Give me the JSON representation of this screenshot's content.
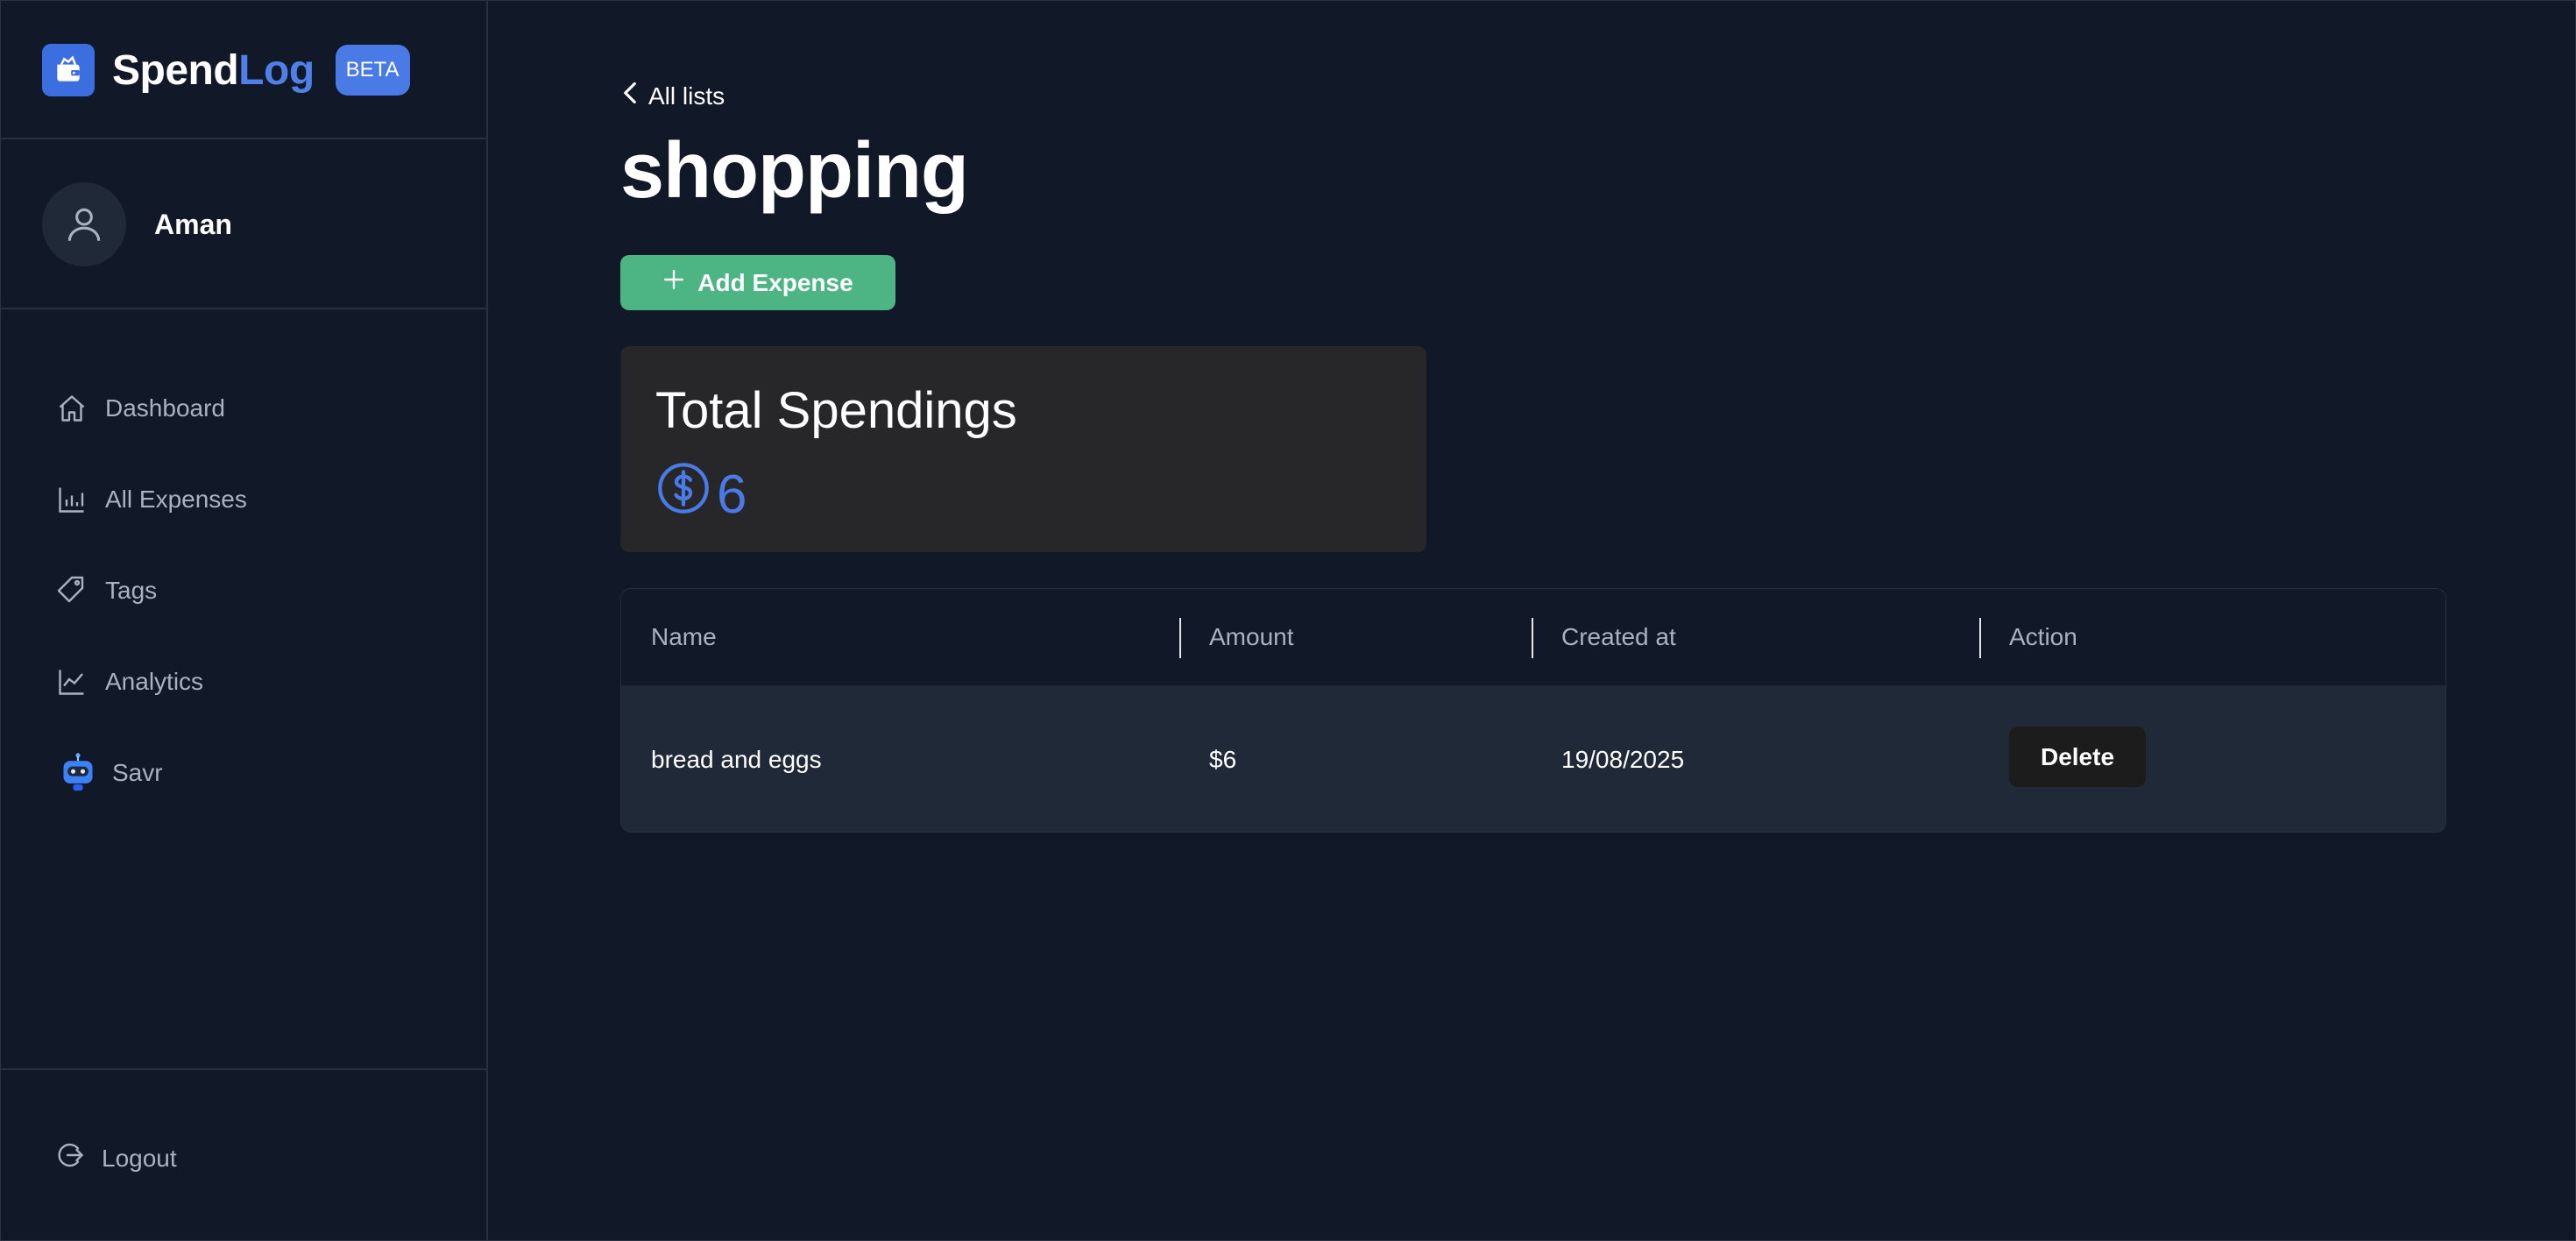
{
  "brand": {
    "name_part1": "Spend",
    "name_part2": "Log",
    "badge": "BETA"
  },
  "user": {
    "name": "Aman"
  },
  "sidebar": {
    "items": [
      {
        "label": "Dashboard",
        "icon": "home-icon"
      },
      {
        "label": "All Expenses",
        "icon": "bar-chart-icon"
      },
      {
        "label": "Tags",
        "icon": "tag-icon"
      },
      {
        "label": "Analytics",
        "icon": "line-chart-icon"
      },
      {
        "label": "Savr",
        "icon": "robot-icon"
      }
    ],
    "logout_label": "Logout"
  },
  "main": {
    "back_label": "All lists",
    "title": "shopping",
    "add_button_label": "Add Expense",
    "total": {
      "title": "Total Spendings",
      "amount": "6",
      "currency_icon": "dollar-circle-icon"
    },
    "table": {
      "columns": [
        "Name",
        "Amount",
        "Created at",
        "Action"
      ],
      "rows": [
        {
          "name": "bread and eggs",
          "amount": "$6",
          "created_at": "19/08/2025",
          "action_label": "Delete"
        }
      ]
    }
  },
  "colors": {
    "background": "#111827",
    "accent_blue": "#4a7ae6",
    "add_green": "#4db584",
    "card": "#27272a",
    "row": "#1f2937"
  }
}
